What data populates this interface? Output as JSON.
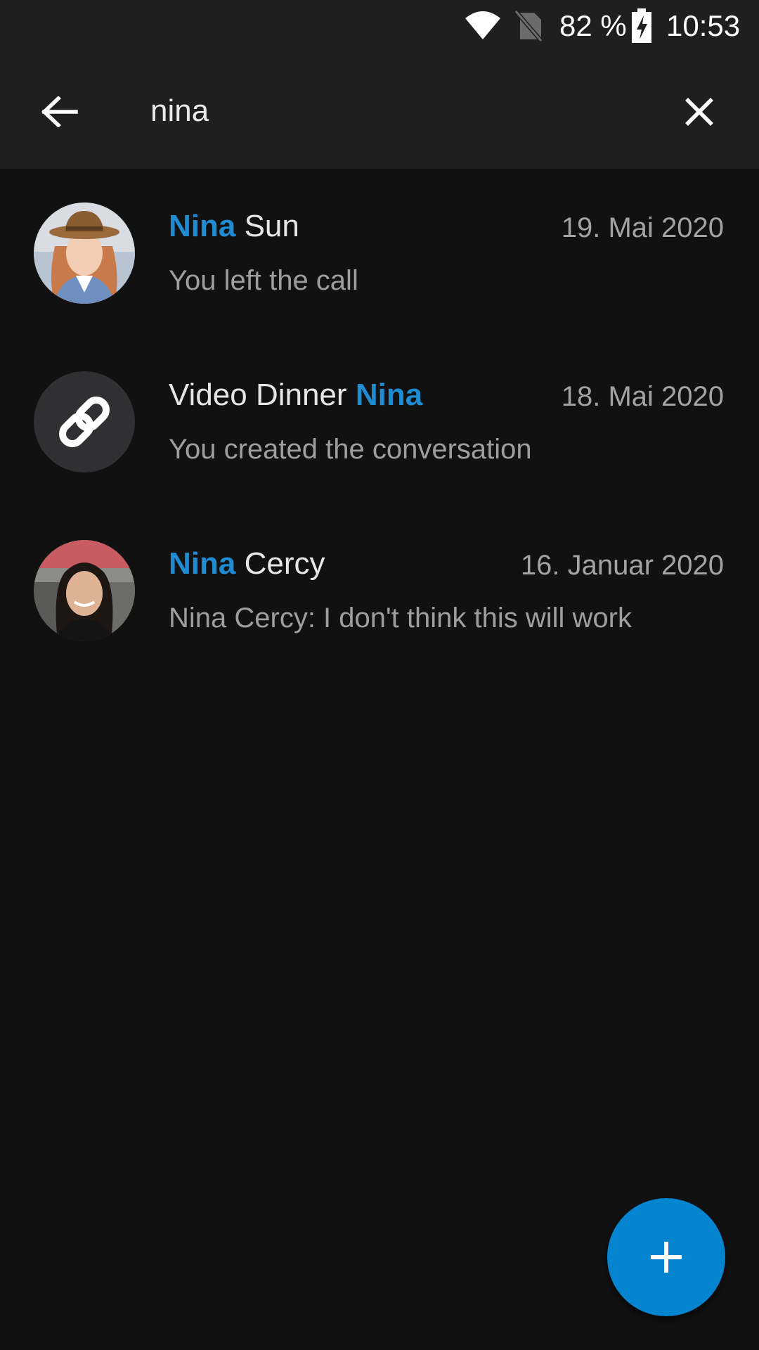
{
  "status_bar": {
    "battery_percent": "82 %",
    "time": "10:53",
    "icons": [
      "wifi-icon",
      "no-sim-icon",
      "battery-charging-icon"
    ]
  },
  "search": {
    "query": "nina",
    "back_icon": "arrow-left-icon",
    "clear_icon": "close-icon"
  },
  "results": [
    {
      "title_parts": [
        {
          "text": "Nina",
          "highlight": true
        },
        {
          "text": " Sun",
          "highlight": false
        }
      ],
      "date": "19. Mai 2020",
      "subtitle": "You left the call",
      "avatar": "user-photo-nina-sun"
    },
    {
      "title_parts": [
        {
          "text": "Video Dinner ",
          "highlight": false
        },
        {
          "text": "Nina",
          "highlight": true
        }
      ],
      "date": "18. Mai 2020",
      "subtitle": "You created the conversation",
      "avatar": "link-icon"
    },
    {
      "title_parts": [
        {
          "text": "Nina",
          "highlight": true
        },
        {
          "text": " Cercy",
          "highlight": false
        }
      ],
      "date": "16. Januar 2020",
      "subtitle": "Nina Cercy: I don't think this will work",
      "avatar": "user-photo-nina-cercy"
    }
  ],
  "fab": {
    "icon": "plus-icon"
  },
  "colors": {
    "background": "#111112",
    "app_bar": "#1f1f20",
    "accent": "#0585d0",
    "highlight_text": "#1f8bd1",
    "primary_text": "#e6e6e6",
    "secondary_text": "#9e9e9e"
  }
}
